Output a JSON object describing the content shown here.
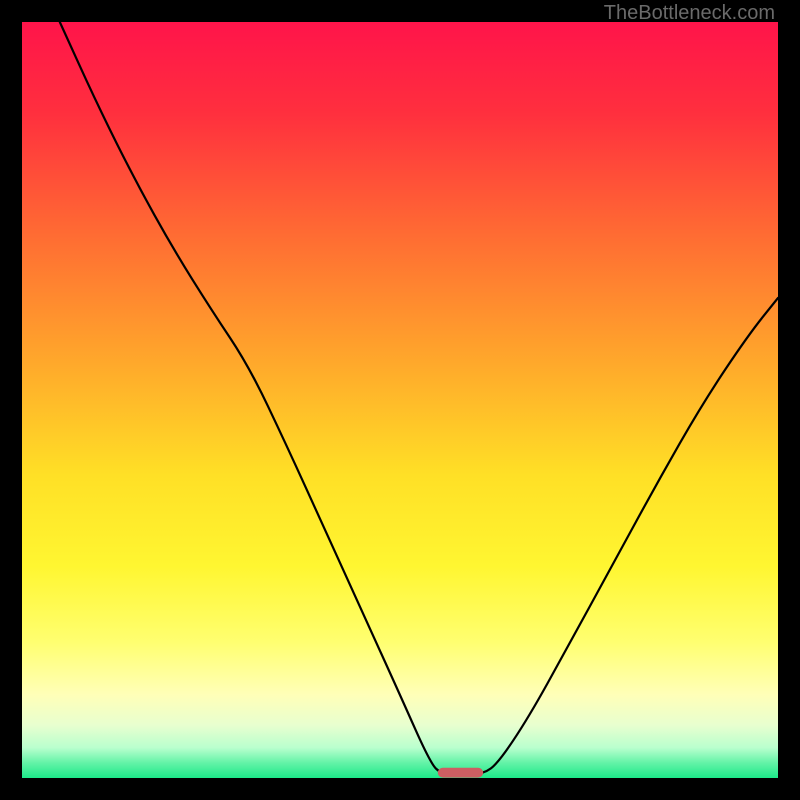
{
  "attribution": "TheBottleneck.com",
  "colors": {
    "frame": "#000000",
    "line": "#000000",
    "marker": "#cd5e62",
    "gradient_stops": [
      {
        "pct": 0,
        "color": "#ff144a"
      },
      {
        "pct": 12,
        "color": "#ff2f3e"
      },
      {
        "pct": 28,
        "color": "#ff6b33"
      },
      {
        "pct": 45,
        "color": "#ffa82b"
      },
      {
        "pct": 60,
        "color": "#ffe026"
      },
      {
        "pct": 72,
        "color": "#fff631"
      },
      {
        "pct": 82,
        "color": "#ffff70"
      },
      {
        "pct": 89,
        "color": "#ffffb8"
      },
      {
        "pct": 93,
        "color": "#e8ffcf"
      },
      {
        "pct": 96,
        "color": "#b9ffce"
      },
      {
        "pct": 98,
        "color": "#63f3a7"
      },
      {
        "pct": 100,
        "color": "#1de989"
      }
    ]
  },
  "chart_data": {
    "type": "line",
    "title": "",
    "xlabel": "",
    "ylabel": "",
    "xlim": [
      0,
      100
    ],
    "ylim": [
      0,
      100
    ],
    "curve": [
      {
        "x": 5.0,
        "y": 100.0
      },
      {
        "x": 10.0,
        "y": 89.0
      },
      {
        "x": 15.0,
        "y": 79.0
      },
      {
        "x": 20.0,
        "y": 70.0
      },
      {
        "x": 25.0,
        "y": 62.0
      },
      {
        "x": 30.0,
        "y": 54.5
      },
      {
        "x": 35.0,
        "y": 44.0
      },
      {
        "x": 40.0,
        "y": 33.0
      },
      {
        "x": 45.0,
        "y": 22.0
      },
      {
        "x": 50.0,
        "y": 11.0
      },
      {
        "x": 54.0,
        "y": 2.0
      },
      {
        "x": 55.5,
        "y": 0.5
      },
      {
        "x": 58.0,
        "y": 0.5
      },
      {
        "x": 61.0,
        "y": 0.5
      },
      {
        "x": 63.0,
        "y": 2.0
      },
      {
        "x": 67.0,
        "y": 8.0
      },
      {
        "x": 72.0,
        "y": 17.0
      },
      {
        "x": 78.0,
        "y": 28.0
      },
      {
        "x": 84.0,
        "y": 39.0
      },
      {
        "x": 90.0,
        "y": 49.5
      },
      {
        "x": 96.0,
        "y": 58.5
      },
      {
        "x": 100.0,
        "y": 63.5
      }
    ],
    "minimum_marker": {
      "x": 58.0,
      "y": 0.7,
      "w": 6.0,
      "h": 1.3
    }
  }
}
